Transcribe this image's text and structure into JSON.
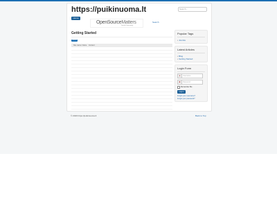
{
  "header": {
    "site_title": "https://puikinuoma.lt",
    "search_placeholder": "Search..."
  },
  "navbar": {
    "home_label": "Home",
    "banner_text_main": "OpenSource",
    "banner_text_accent": "Matters",
    "banner_subtext": "Joomla Community",
    "search_link": "Search"
  },
  "content": {
    "page_heading": "Getting Started",
    "badge_label": "Untitled",
    "grid_columns": [
      "Site name: Name",
      "Content"
    ],
    "row_count": 18
  },
  "sidebar": {
    "popular_tags": {
      "title": "Popular Tags",
      "items": [
        "Joomla"
      ]
    },
    "latest_articles": {
      "title": "Latest Articles",
      "items": [
        "Blog",
        "Getting Started"
      ]
    },
    "login_form": {
      "title": "Login Form",
      "username_placeholder": "Username",
      "password_placeholder": "Password",
      "remember_label": "Remember Me",
      "login_button": "Log in",
      "forgot_username": "Forgot your username?",
      "forgot_password": "Forgot your password?"
    }
  },
  "footer": {
    "copyright": "© 2020 https://puikinuoma.lt",
    "back_to_top": "Back to Top"
  },
  "colors": {
    "accent": "#1b6fb3",
    "button": "#1b5f97",
    "link": "#2a6fb0"
  }
}
